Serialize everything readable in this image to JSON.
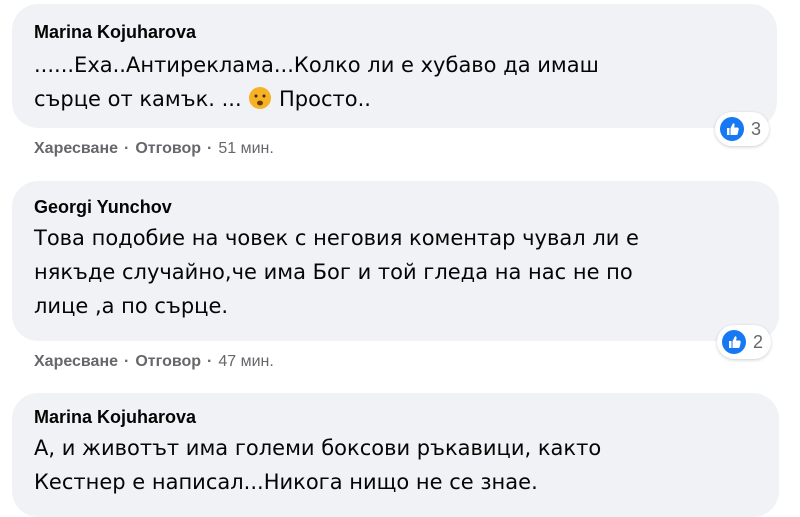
{
  "comments": [
    {
      "author": "Marina Kojuharova",
      "line1": "......Еха..Антиреклама...Колко ли е хубаво да имаш",
      "line2a": "сърце от камък. ... ",
      "emoji_icon": "frowning-face-icon",
      "line2b": " Просто..",
      "reaction_icon": "like-icon",
      "reaction_count": "3",
      "like_label": "Харесване",
      "reply_label": "Отговор",
      "time": "51 мин."
    },
    {
      "author": "Georgi Yunchov",
      "line1": "Това подобие на човек с неговия коментар чувал ли е",
      "line2": "някъде случайно,че има Бог и той гледа на нас не по",
      "line3": "лице ,а по сърце.",
      "reaction_icon": "like-icon",
      "reaction_count": "2",
      "like_label": "Харесване",
      "reply_label": "Отговор",
      "time": "47 мин."
    },
    {
      "author": "Marina Kojuharova",
      "line1": "А, и животът има големи боксови ръкавици, както",
      "line2": "Кестнер е написал...Никога нищо не се знае."
    }
  ],
  "colors": {
    "bubble": "#f0f2f5",
    "meta_text": "#65676b",
    "like_blue": "#1877f2",
    "emoji_yellow": "#f7b125"
  },
  "separator": "·"
}
